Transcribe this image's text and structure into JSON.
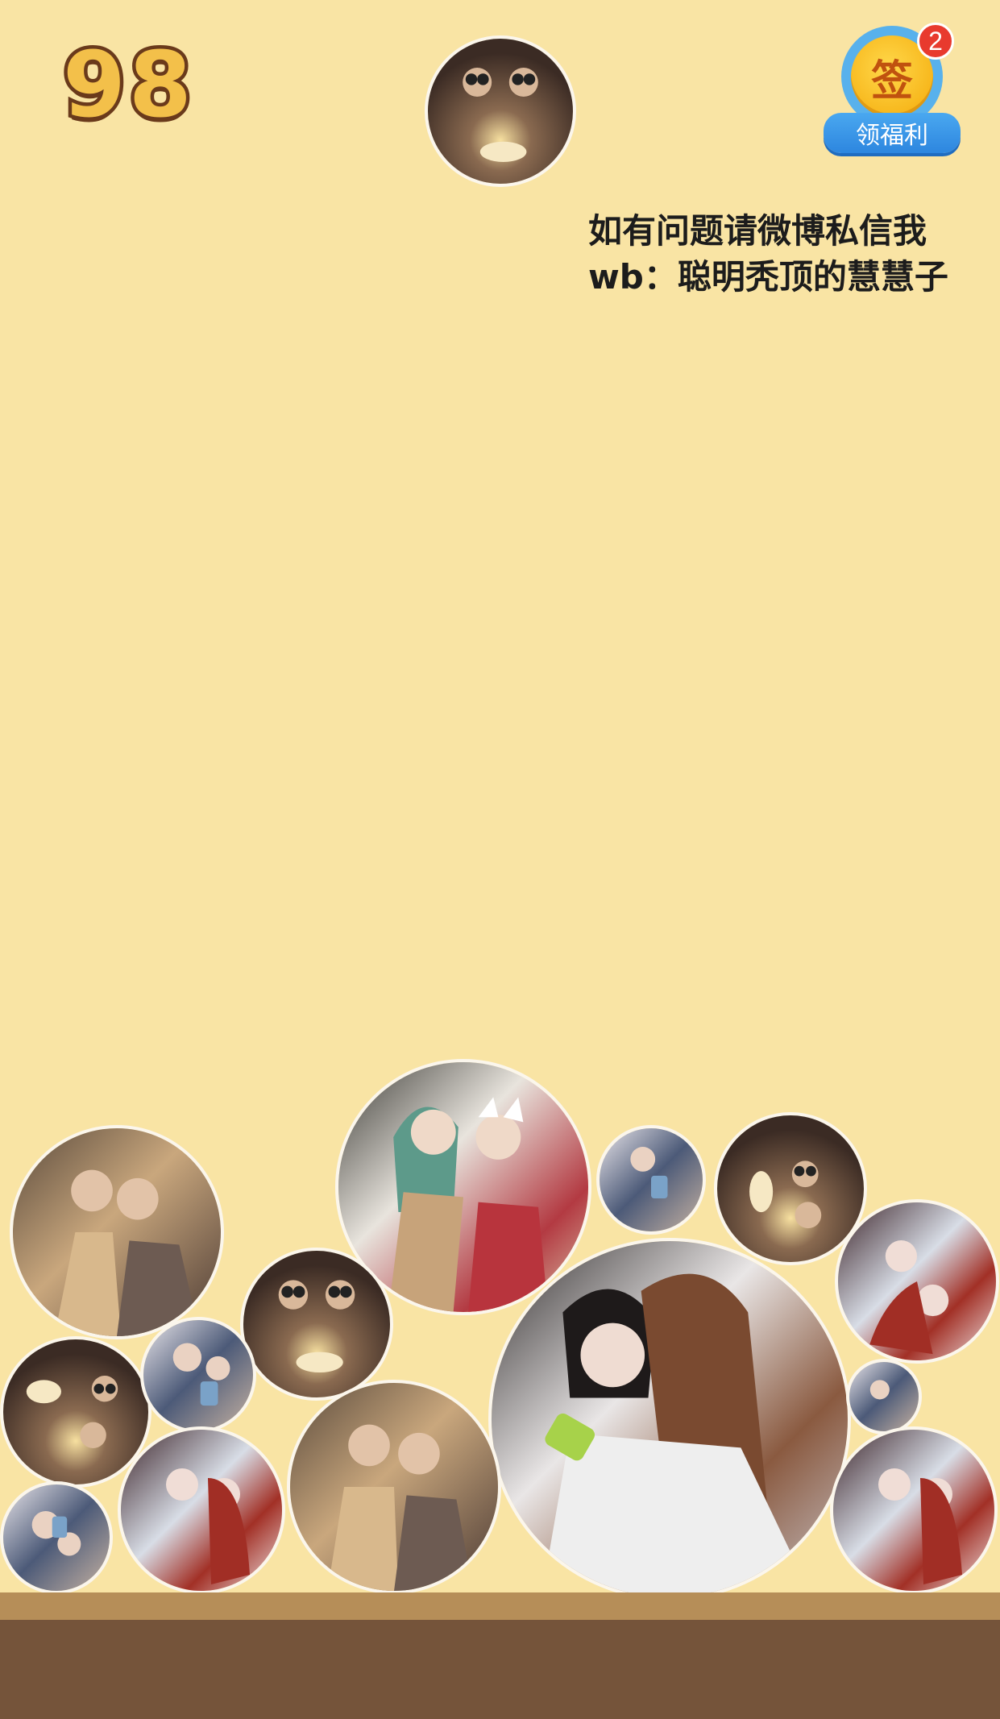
{
  "score": "98",
  "signin": {
    "icon_char": "签",
    "badge_count": "2",
    "label": "领福利"
  },
  "contact": {
    "line1": "如有问题请微博私信我",
    "line2": "wb：聪明秃顶的慧慧子"
  },
  "next_ball": {
    "photo": "birthday-cake-two-girls"
  },
  "balls": [
    {
      "photo": "two-girls-jackets"
    },
    {
      "photo": "two-girls-green-hair"
    },
    {
      "photo": "mirror-selfie-small"
    },
    {
      "photo": "birthday-cake-two-girls"
    },
    {
      "photo": "birthday-cake-two-girls"
    },
    {
      "photo": "two-girls-hug"
    },
    {
      "photo": "two-girls-red-hair"
    },
    {
      "photo": "birthday-cake-two-girls"
    },
    {
      "photo": "mirror-selfie-small"
    },
    {
      "photo": "mirror-selfie-tiny"
    },
    {
      "photo": "two-girls-jackets"
    },
    {
      "photo": "two-girls-red-hair"
    },
    {
      "photo": "two-girls-red-hair"
    },
    {
      "photo": "mirror-selfie-small"
    }
  ],
  "colors": {
    "background": "#f9e4a4",
    "ground": "#75543a",
    "ground_edge": "#b68e58"
  }
}
